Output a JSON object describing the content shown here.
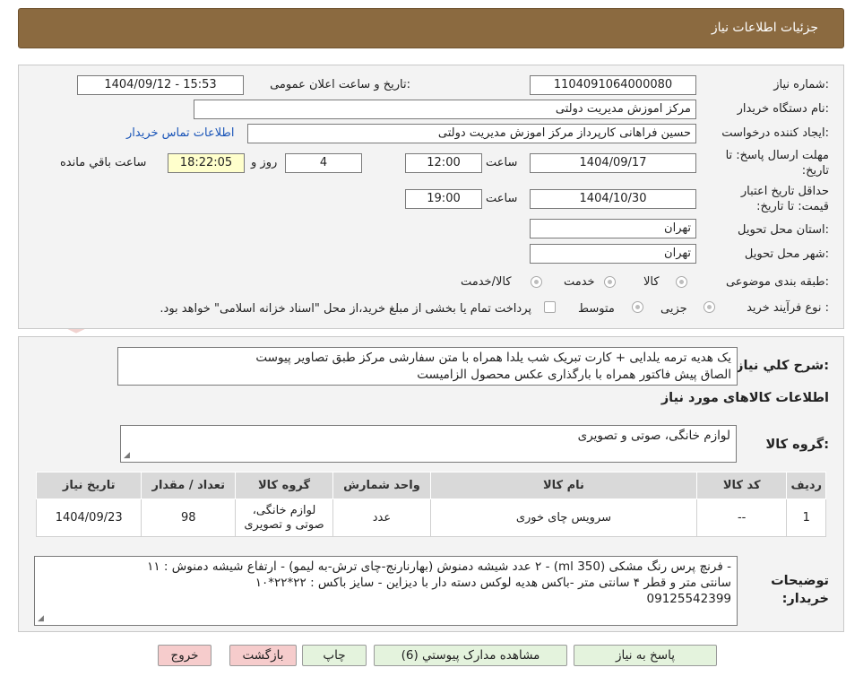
{
  "header": {
    "title": "جزئیات اطلاعات نیاز"
  },
  "form": {
    "need_number_label": "شماره نیاز:",
    "need_number": "1104091064000080",
    "announce_label": "تاریخ و ساعت اعلان عمومی:",
    "announce_value": "1404/09/12 - 15:53",
    "buyer_org_label": "نام دستگاه خریدار:",
    "buyer_org": "مرکز اموزش مدیریت دولتی",
    "requester_label": "ایجاد کننده درخواست:",
    "requester": "حسین  فراهانی کارپرداز مرکز اموزش مدیریت دولتی",
    "contact_link": "اطلاعات تماس خریدار",
    "deadline_label": "مهلت ارسال پاسخ: تا تاریخ:",
    "deadline_date": "1404/09/17",
    "time_label": "ساعت",
    "deadline_time": "12:00",
    "days": "4",
    "days_label": "روز و",
    "remaining_time": "18:22:05",
    "remaining_label": "ساعت باقي مانده",
    "validity_label": "حداقل تاریخ اعتبار قیمت: تا تاریخ:",
    "validity_date": "1404/10/30",
    "validity_time": "19:00",
    "province_label": "استان محل تحویل:",
    "province": "تهران",
    "city_label": "شهر محل تحویل:",
    "city": "تهران",
    "category_label": "طبقه بندی موضوعی:",
    "category_options": [
      "کالا",
      "خدمت",
      "کالا/خدمت"
    ],
    "purchase_type_label": "نوع فرآیند خرید :",
    "purchase_options": [
      "جزیی",
      "متوسط"
    ],
    "payment_note": "پرداخت تمام یا بخشی از مبلغ خرید،از محل \"اسناد خزانه اسلامی\" خواهد بود."
  },
  "description": {
    "label": "شرح کلي نیاز:",
    "line1": "یک هدیه ترمه یلدایی + کارت تبریک شب یلدا همراه با متن سفارشی مرکز طبق تصاویر پیوست",
    "line2": "الصاق پیش فاکتور همراه با بارگذاری عکس محصول الزامیست"
  },
  "goods": {
    "section_title": "اطلاعات کالاهای مورد نیاز",
    "group_label": "گروه کالا:",
    "group_value": "لوازم خانگی، صوتی و تصویری",
    "columns": [
      "ردیف",
      "کد کالا",
      "نام کالا",
      "واحد شمارش",
      "گروه کالا",
      "تعداد / مقدار",
      "تاریخ نیاز"
    ],
    "rows": [
      {
        "row": "1",
        "code": "--",
        "name": "سرویس چای خوری",
        "unit": "عدد",
        "group": "لوازم خانگی، صوتی و تصویری",
        "qty": "98",
        "date": "1404/09/23"
      }
    ]
  },
  "buyer_notes": {
    "label": "توضیحات خریدار:",
    "line1": "- فرنچ پرس رنگ مشکی (350 ml) - ۲ عدد شیشه دمنوش (بهارنارنج-چای ترش-به لیمو) - ارتفاع شیشه دمنوش : ۱۱",
    "line2": "سانتی متر و قطر ۴ سانتی متر -باکس هدیه لوکس دسته دار با دیزاین - سایز باکس : ۲۲*۲۲*۱۰",
    "line3": "09125542399"
  },
  "buttons": {
    "reply": "پاسخ به نیاز",
    "attachments": "مشاهده مدارک پیوستي (6)",
    "print": "چاپ",
    "back": "بازگشت",
    "exit": "خروج"
  },
  "colors": {
    "header_bg": "#8b6a40",
    "link": "#1a55b8",
    "remaining_bg": "#ffffcc",
    "pink_button": "#f6cccc",
    "green_button": "#e4f3dd"
  }
}
